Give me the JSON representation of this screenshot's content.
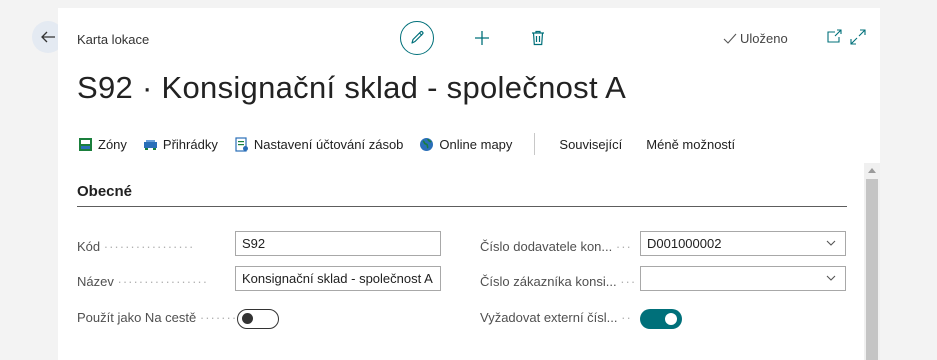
{
  "header": {
    "page_kind": "Karta lokace",
    "saved_status": "Uloženo",
    "title": "S92 · Konsignační sklad - společnost A"
  },
  "actions": {
    "zones": "Zóny",
    "bins": "Přihrádky",
    "inventory_posting": "Nastavení účtování zásob",
    "online_maps": "Online mapy",
    "related": "Související",
    "fewer_options": "Méně možností"
  },
  "section": {
    "title": "Obecné"
  },
  "fields": {
    "code": {
      "label": "Kód",
      "value": "S92"
    },
    "name": {
      "label": "Název",
      "value": "Konsignační sklad - společnost A"
    },
    "use_as_in_transit": {
      "label": "Použít jako Na cestě",
      "state": "off"
    },
    "vendor_no": {
      "label": "Číslo dodavatele kon...",
      "value": "D001000002"
    },
    "customer_no": {
      "label": "Číslo zákazníka konsi...",
      "value": ""
    },
    "require_external": {
      "label": "Vyžadovat externí čísl...",
      "state": "on"
    }
  },
  "colors": {
    "accent": "#00707a",
    "background": "#f3f3f3",
    "card": "#ffffff"
  }
}
